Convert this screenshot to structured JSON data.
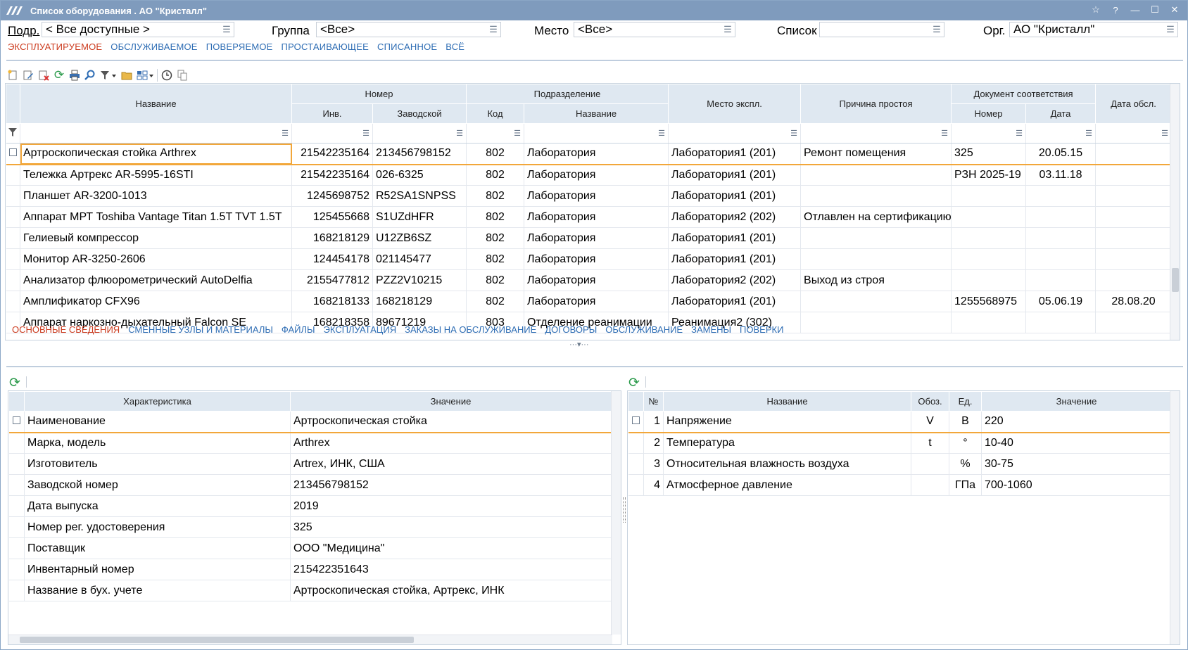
{
  "window": {
    "title": "Список оборудования . АО \"Кристалл\""
  },
  "filters": {
    "podr_label": "Подр.",
    "podr_value": "< Все доступные >",
    "group_label": "Группа",
    "group_value": "<Все>",
    "place_label": "Место",
    "place_value": "<Все>",
    "list_label": "Список",
    "list_value": "",
    "org_label": "Орг.",
    "org_value": "АО \"Кристалл\""
  },
  "top_tabs": [
    "ЭКСПЛУАТИРУЕМОЕ",
    "ОБСЛУЖИВАЕМОЕ",
    "ПОВЕРЯЕМОЕ",
    "ПРОСТАИВАЮЩЕЕ",
    "СПИСАННОЕ",
    "ВСЁ"
  ],
  "main_grid": {
    "headers": {
      "name": "Название",
      "number": "Номер",
      "inv": "Инв.",
      "serial": "Заводской",
      "division": "Подразделение",
      "code": "Код",
      "div_name": "Название",
      "place": "Место экспл.",
      "reason": "Причина простоя",
      "doc": "Документ соответствия",
      "doc_num": "Номер",
      "doc_date": "Дата",
      "service_date": "Дата обсл."
    },
    "rows": [
      {
        "name": "Артроскопическая стойка Arthrex",
        "inv": "21542235164",
        "serial": "213456798152",
        "code": "802",
        "div": "Лаборатория",
        "place": "Лаборатория1 (201)",
        "reason": "Ремонт помещения",
        "doc_num": "325",
        "doc_date": "20.05.15",
        "service": ""
      },
      {
        "name": "Тележка Артрекс AR-5995-16STI",
        "inv": "21542235164",
        "serial": "026-6325",
        "code": "802",
        "div": "Лаборатория",
        "place": "Лаборатория1 (201)",
        "reason": "",
        "doc_num": "РЗН 2025-19",
        "doc_date": "03.11.18",
        "service": ""
      },
      {
        "name": "Планшет AR-3200-1013",
        "inv": "1245698752",
        "serial": "R52SA1SNPSS",
        "code": "802",
        "div": "Лаборатория",
        "place": "Лаборатория1 (201)",
        "reason": "",
        "doc_num": "",
        "doc_date": "",
        "service": ""
      },
      {
        "name": "Аппарат МРТ Toshiba Vantage Titan 1.5T TVT 1.5T",
        "inv": "125455668",
        "serial": "S1UZdHFR",
        "code": "802",
        "div": "Лаборатория",
        "place": "Лаборатория2 (202)",
        "reason": "Отлавлен на сертификацию",
        "doc_num": "",
        "doc_date": "",
        "service": ""
      },
      {
        "name": "Гелиевый компрессор",
        "inv": "168218129",
        "serial": "U12ZB6SZ",
        "code": "802",
        "div": "Лаборатория",
        "place": "Лаборатория1 (201)",
        "reason": "",
        "doc_num": "",
        "doc_date": "",
        "service": ""
      },
      {
        "name": "Монитор AR-3250-2606",
        "inv": "124454178",
        "serial": "021145477",
        "code": "802",
        "div": "Лаборатория",
        "place": "Лаборатория1 (201)",
        "reason": "",
        "doc_num": "",
        "doc_date": "",
        "service": ""
      },
      {
        "name": "Анализатор флюорометрический AutoDelfia",
        "inv": "2155477812",
        "serial": "PZZ2V10215",
        "code": "802",
        "div": "Лаборатория",
        "place": "Лаборатория2 (202)",
        "reason": "Выход из строя",
        "doc_num": "",
        "doc_date": "",
        "service": ""
      },
      {
        "name": "Амплификатор CFX96",
        "inv": "168218133",
        "serial": "168218129",
        "code": "802",
        "div": "Лаборатория",
        "place": "Лаборатория1 (201)",
        "reason": "",
        "doc_num": "1255568975",
        "doc_date": "05.06.19",
        "service": "28.08.20"
      },
      {
        "name": "Аппарат наркозно-дыхательный Falcon SE",
        "inv": "168218358",
        "serial": "89671219",
        "code": "803",
        "div": "Отделение  реанимации",
        "place": "Реанимация2 (302)",
        "reason": "",
        "doc_num": "",
        "doc_date": "",
        "service": ""
      }
    ]
  },
  "bottom_tabs": [
    "ОСНОВНЫЕ СВЕДЕНИЯ",
    "СМЕННЫЕ УЗЛЫ И МАТЕРИАЛЫ",
    "ФАЙЛЫ",
    "ЭКСПЛУАТАЦИЯ",
    "ЗАКАЗЫ НА ОБСЛУЖИВАНИЕ",
    "ДОГОВОРЫ",
    "ОБСЛУЖИВАНИЕ",
    "ЗАМЕНЫ",
    "ПОВЕРКИ"
  ],
  "details": {
    "headers": {
      "char": "Характеристика",
      "value": "Значение"
    },
    "rows": [
      {
        "k": "Наименование",
        "v": "Артроскопическая стойка"
      },
      {
        "k": "Марка, модель",
        "v": "Arthrex"
      },
      {
        "k": "Изготовитель",
        "v": "Artrex, ИНК, США"
      },
      {
        "k": "Заводской номер",
        "v": "213456798152"
      },
      {
        "k": "Дата выпуска",
        "v": "2019"
      },
      {
        "k": "Номер рег. удостоверения",
        "v": "325"
      },
      {
        "k": "Поставщик",
        "v": "ООО \"Медицина\""
      },
      {
        "k": "Инвентарный номер",
        "v": "215422351643"
      },
      {
        "k": "Название в бух. учете",
        "v": "Артроскопическая стойка, Артрекс, ИНК"
      }
    ]
  },
  "params": {
    "headers": {
      "no": "№",
      "name": "Название",
      "sym": "Обоз.",
      "unit": "Ед.",
      "value": "Значение"
    },
    "rows": [
      {
        "no": "1",
        "name": "Напряжение",
        "sym": "V",
        "unit": "В",
        "value": "220"
      },
      {
        "no": "2",
        "name": "Температура",
        "sym": "t",
        "unit": "°",
        "value": "10-40"
      },
      {
        "no": "3",
        "name": "Относительная влажность воздуха",
        "sym": "",
        "unit": "%",
        "value": "30-75"
      },
      {
        "no": "4",
        "name": "Атмосферное давление",
        "sym": "",
        "unit": "ГПа",
        "value": "700-1060"
      }
    ]
  },
  "colors": {
    "titlebar": "#7f9bbd",
    "active_tab": "#cc3b1e",
    "link": "#2e6db4",
    "selection": "#f2a73a",
    "header_bg": "#dfe8f1"
  }
}
